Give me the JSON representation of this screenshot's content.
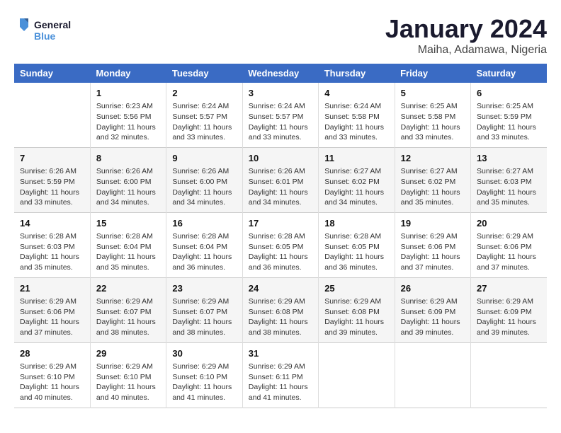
{
  "logo": {
    "line1": "General",
    "line2": "Blue"
  },
  "calendar": {
    "title": "January 2024",
    "subtitle": "Maiha, Adamawa, Nigeria"
  },
  "headers": [
    "Sunday",
    "Monday",
    "Tuesday",
    "Wednesday",
    "Thursday",
    "Friday",
    "Saturday"
  ],
  "weeks": [
    [
      {
        "num": "",
        "text": ""
      },
      {
        "num": "1",
        "text": "Sunrise: 6:23 AM\nSunset: 5:56 PM\nDaylight: 11 hours\nand 32 minutes."
      },
      {
        "num": "2",
        "text": "Sunrise: 6:24 AM\nSunset: 5:57 PM\nDaylight: 11 hours\nand 33 minutes."
      },
      {
        "num": "3",
        "text": "Sunrise: 6:24 AM\nSunset: 5:57 PM\nDaylight: 11 hours\nand 33 minutes."
      },
      {
        "num": "4",
        "text": "Sunrise: 6:24 AM\nSunset: 5:58 PM\nDaylight: 11 hours\nand 33 minutes."
      },
      {
        "num": "5",
        "text": "Sunrise: 6:25 AM\nSunset: 5:58 PM\nDaylight: 11 hours\nand 33 minutes."
      },
      {
        "num": "6",
        "text": "Sunrise: 6:25 AM\nSunset: 5:59 PM\nDaylight: 11 hours\nand 33 minutes."
      }
    ],
    [
      {
        "num": "7",
        "text": "Sunrise: 6:26 AM\nSunset: 5:59 PM\nDaylight: 11 hours\nand 33 minutes."
      },
      {
        "num": "8",
        "text": "Sunrise: 6:26 AM\nSunset: 6:00 PM\nDaylight: 11 hours\nand 34 minutes."
      },
      {
        "num": "9",
        "text": "Sunrise: 6:26 AM\nSunset: 6:00 PM\nDaylight: 11 hours\nand 34 minutes."
      },
      {
        "num": "10",
        "text": "Sunrise: 6:26 AM\nSunset: 6:01 PM\nDaylight: 11 hours\nand 34 minutes."
      },
      {
        "num": "11",
        "text": "Sunrise: 6:27 AM\nSunset: 6:02 PM\nDaylight: 11 hours\nand 34 minutes."
      },
      {
        "num": "12",
        "text": "Sunrise: 6:27 AM\nSunset: 6:02 PM\nDaylight: 11 hours\nand 35 minutes."
      },
      {
        "num": "13",
        "text": "Sunrise: 6:27 AM\nSunset: 6:03 PM\nDaylight: 11 hours\nand 35 minutes."
      }
    ],
    [
      {
        "num": "14",
        "text": "Sunrise: 6:28 AM\nSunset: 6:03 PM\nDaylight: 11 hours\nand 35 minutes."
      },
      {
        "num": "15",
        "text": "Sunrise: 6:28 AM\nSunset: 6:04 PM\nDaylight: 11 hours\nand 35 minutes."
      },
      {
        "num": "16",
        "text": "Sunrise: 6:28 AM\nSunset: 6:04 PM\nDaylight: 11 hours\nand 36 minutes."
      },
      {
        "num": "17",
        "text": "Sunrise: 6:28 AM\nSunset: 6:05 PM\nDaylight: 11 hours\nand 36 minutes."
      },
      {
        "num": "18",
        "text": "Sunrise: 6:28 AM\nSunset: 6:05 PM\nDaylight: 11 hours\nand 36 minutes."
      },
      {
        "num": "19",
        "text": "Sunrise: 6:29 AM\nSunset: 6:06 PM\nDaylight: 11 hours\nand 37 minutes."
      },
      {
        "num": "20",
        "text": "Sunrise: 6:29 AM\nSunset: 6:06 PM\nDaylight: 11 hours\nand 37 minutes."
      }
    ],
    [
      {
        "num": "21",
        "text": "Sunrise: 6:29 AM\nSunset: 6:06 PM\nDaylight: 11 hours\nand 37 minutes."
      },
      {
        "num": "22",
        "text": "Sunrise: 6:29 AM\nSunset: 6:07 PM\nDaylight: 11 hours\nand 38 minutes."
      },
      {
        "num": "23",
        "text": "Sunrise: 6:29 AM\nSunset: 6:07 PM\nDaylight: 11 hours\nand 38 minutes."
      },
      {
        "num": "24",
        "text": "Sunrise: 6:29 AM\nSunset: 6:08 PM\nDaylight: 11 hours\nand 38 minutes."
      },
      {
        "num": "25",
        "text": "Sunrise: 6:29 AM\nSunset: 6:08 PM\nDaylight: 11 hours\nand 39 minutes."
      },
      {
        "num": "26",
        "text": "Sunrise: 6:29 AM\nSunset: 6:09 PM\nDaylight: 11 hours\nand 39 minutes."
      },
      {
        "num": "27",
        "text": "Sunrise: 6:29 AM\nSunset: 6:09 PM\nDaylight: 11 hours\nand 39 minutes."
      }
    ],
    [
      {
        "num": "28",
        "text": "Sunrise: 6:29 AM\nSunset: 6:10 PM\nDaylight: 11 hours\nand 40 minutes."
      },
      {
        "num": "29",
        "text": "Sunrise: 6:29 AM\nSunset: 6:10 PM\nDaylight: 11 hours\nand 40 minutes."
      },
      {
        "num": "30",
        "text": "Sunrise: 6:29 AM\nSunset: 6:10 PM\nDaylight: 11 hours\nand 41 minutes."
      },
      {
        "num": "31",
        "text": "Sunrise: 6:29 AM\nSunset: 6:11 PM\nDaylight: 11 hours\nand 41 minutes."
      },
      {
        "num": "",
        "text": ""
      },
      {
        "num": "",
        "text": ""
      },
      {
        "num": "",
        "text": ""
      }
    ]
  ]
}
